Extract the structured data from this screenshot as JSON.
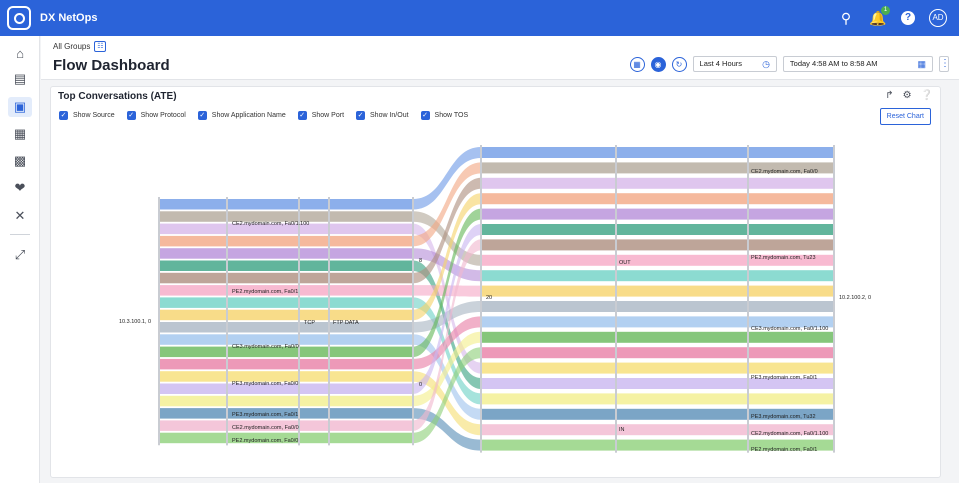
{
  "app": {
    "name": "DX NetOps"
  },
  "topbar": {
    "notification_count": "1",
    "avatar": "AD"
  },
  "header": {
    "breadcrumb": "All Groups",
    "title": "Flow Dashboard",
    "time_range": "Last 4 Hours",
    "date_range": "Today 4:58 AM to 8:58 AM"
  },
  "panel": {
    "title": "Top Conversations (ATE)",
    "options": [
      "Show Source",
      "Show Protocol",
      "Show Application Name",
      "Show Port",
      "Show In/Out",
      "Show TOS"
    ],
    "reset_label": "Reset Chart"
  },
  "sankey": {
    "colors": [
      "#6f9be6",
      "#b3a99b",
      "#d7b8ea",
      "#f2a884",
      "#b68fd9",
      "#3aa383",
      "#ae8f7f",
      "#f6a9c6",
      "#6fd2c6",
      "#f6d36b",
      "#aab7c4",
      "#9fc4ee",
      "#66b85a",
      "#e97fa6",
      "#f6df75",
      "#c9b6f0",
      "#f3ef8d",
      "#5a8fb8",
      "#f1b8cf",
      "#8fd17b"
    ],
    "nodes": {
      "source": "10.3.100.1, 0",
      "protocol": "TCP",
      "application": "FTP DATA",
      "port_a": "8",
      "port_b": "20",
      "port_c": "0",
      "dir_out": "OUT",
      "dir_in": "IN",
      "destination": "10.2.100.2, 0"
    },
    "left_interfaces": [
      "CE2.mydomain.com, Fa0/1.100",
      "PE2.mydomain.com, Fa0/1",
      "CE3.mydomain.com, Fa0/0",
      "PE3.mydomain.com, Fa0/0",
      "PE3.mydomain.com, Fa0/1",
      "CE2.mydomain.com, Fa0/0",
      "PE2.mydomain.com, Fa0/0"
    ],
    "right_interfaces": [
      "CE2.mydomain.com, Fa0/0",
      "PE2.mydomain.com, Tu23",
      "CE3.mydomain.com, Fa0/1.100",
      "PE3.mydomain.com, Fa0/1",
      "PE3.mydomain.com, Tu32",
      "CE2.mydomain.com, Fa0/1.100",
      "PE2.mydomain.com, Fa0/1"
    ]
  }
}
